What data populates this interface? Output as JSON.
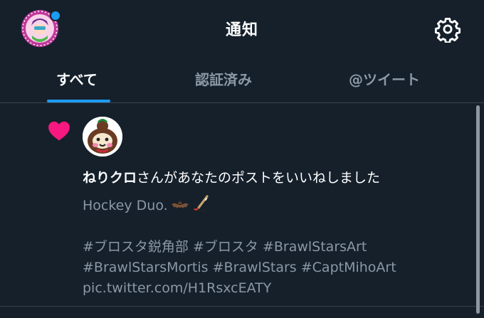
{
  "header": {
    "title": "通知"
  },
  "tabs": [
    {
      "label": "すべて",
      "active": true
    },
    {
      "label": "認証済み",
      "active": false
    },
    {
      "label": "@ツイート",
      "active": false
    }
  ],
  "notification": {
    "type_icon": "heart-icon",
    "liker_name": "ねりクロ",
    "action_text": "さんがあなたのポストをいいねしました",
    "post_text": "Hockey Duo.",
    "post_emojis": [
      "bat",
      "hockey-stick"
    ],
    "hashtags_line1": [
      "#ブロスタ鋭角部",
      "#ブロスタ",
      "#BrawlStarsArt"
    ],
    "hashtags_line2": [
      "#BrawlStarsMortis",
      "#BrawlStars",
      "#CaptMihoArt"
    ],
    "link": "pic.twitter.com/H1RsxcEATY"
  },
  "colors": {
    "background": "#15202b",
    "accent": "#1d9bf0",
    "heart": "#f91880",
    "muted_text": "#8b98a5",
    "divider": "#38444d"
  }
}
